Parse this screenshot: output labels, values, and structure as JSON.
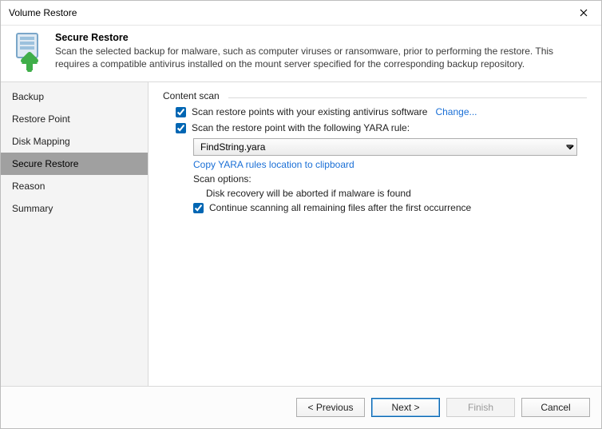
{
  "window": {
    "title": "Volume Restore"
  },
  "header": {
    "title": "Secure Restore",
    "description": "Scan the selected backup for malware, such as computer viruses or ransomware, prior to performing the restore. This requires a compatible antivirus installed on the mount server specified for the corresponding backup repository."
  },
  "sidebar": {
    "items": [
      {
        "label": "Backup"
      },
      {
        "label": "Restore Point"
      },
      {
        "label": "Disk Mapping"
      },
      {
        "label": "Secure Restore"
      },
      {
        "label": "Reason"
      },
      {
        "label": "Summary"
      }
    ],
    "active_index": 3
  },
  "content": {
    "group_label": "Content scan",
    "scan_av": {
      "checked": true,
      "label": "Scan restore points with your existing antivirus software",
      "change_link": "Change..."
    },
    "scan_yara": {
      "checked": true,
      "label": "Scan the restore point with the following YARA rule:",
      "selected_rule": "FindString.yara",
      "copy_link": "Copy YARA rules location to clipboard"
    },
    "scan_options": {
      "heading": "Scan options:",
      "abort_text": "Disk recovery will be aborted if malware is found",
      "continue": {
        "checked": true,
        "label": "Continue scanning all remaining files after the first occurrence"
      }
    }
  },
  "footer": {
    "previous": "< Previous",
    "next": "Next >",
    "finish": "Finish",
    "cancel": "Cancel"
  }
}
